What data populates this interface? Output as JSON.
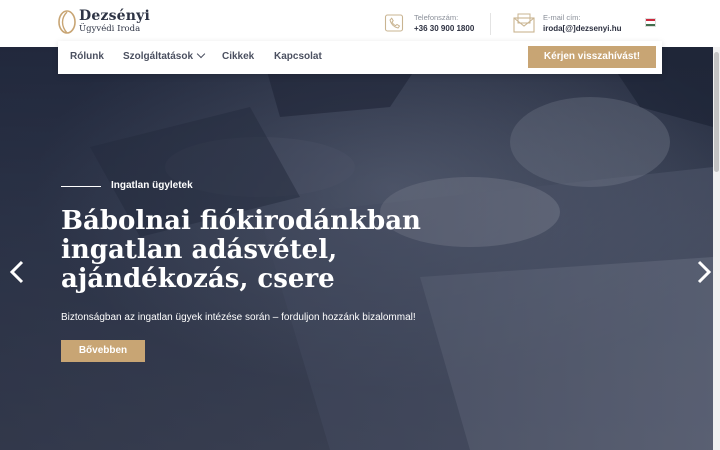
{
  "brand": {
    "name": "Dezsényi",
    "subtitle": "Ügyvédi Iroda",
    "accent": "#c8a574",
    "dark": "#2e3445"
  },
  "contact": {
    "phone_label": "Telefonszám:",
    "phone_value": "+36 30 900 1800",
    "email_label": "E-mail cím:",
    "email_value": "iroda[@]dezsenyi.hu",
    "flag": "hungary-flag-icon"
  },
  "nav": {
    "items": [
      {
        "label": "Rólunk"
      },
      {
        "label": "Szolgáltatások"
      },
      {
        "label": "Cikkek"
      },
      {
        "label": "Kapcsolat"
      }
    ],
    "cta_label": "Kérjen visszahívást!"
  },
  "hero": {
    "eyebrow": "Ingatlan ügyletek",
    "headline": "Bábolnai fiókirodánkban ingatlan adásvétel, ajándékozás, csere",
    "lead": "Biztonságban az ingatlan ügyek intézése során – forduljon hozzánk bizalommal!",
    "button_label": "Bővebben",
    "prev_icon": "chevron-left-icon",
    "next_icon": "chevron-right-icon"
  }
}
